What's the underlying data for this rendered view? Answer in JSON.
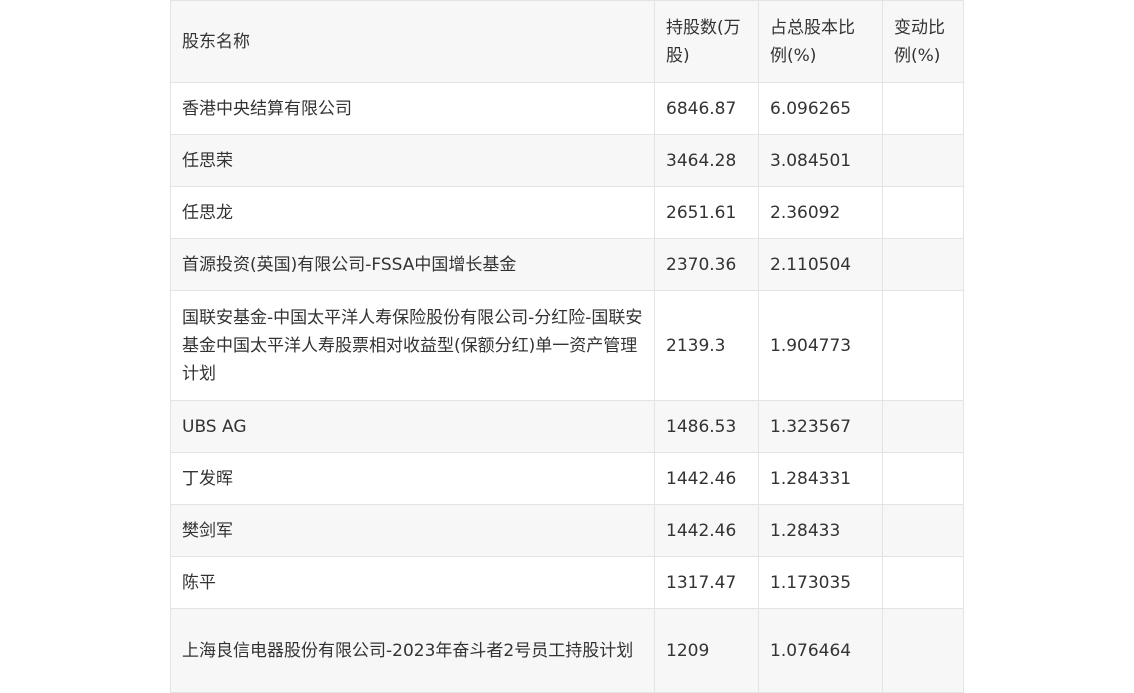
{
  "table": {
    "headers": [
      "股东名称",
      "持股数(万股)",
      "占总股本比例(%)",
      "变动比例(%)"
    ],
    "rows": [
      {
        "name": "香港中央结算有限公司",
        "shares": "6846.87",
        "ratio": "6.096265",
        "change": ""
      },
      {
        "name": "任思荣",
        "shares": "3464.28",
        "ratio": "3.084501",
        "change": ""
      },
      {
        "name": "任思龙",
        "shares": "2651.61",
        "ratio": "2.36092",
        "change": ""
      },
      {
        "name": "首源投资(英国)有限公司-FSSA中国增长基金",
        "shares": "2370.36",
        "ratio": "2.110504",
        "change": ""
      },
      {
        "name": "国联安基金-中国太平洋人寿保险股份有限公司-分红险-国联安基金中国太平洋人寿股票相对收益型(保额分红)单一资产管理计划",
        "shares": "2139.3",
        "ratio": "1.904773",
        "change": ""
      },
      {
        "name": "UBS AG",
        "shares": "1486.53",
        "ratio": "1.323567",
        "change": ""
      },
      {
        "name": "丁发晖",
        "shares": "1442.46",
        "ratio": "1.284331",
        "change": ""
      },
      {
        "name": "樊剑军",
        "shares": "1442.46",
        "ratio": "1.28433",
        "change": ""
      },
      {
        "name": "陈平",
        "shares": "1317.47",
        "ratio": "1.173035",
        "change": ""
      },
      {
        "name": "上海良信电器股份有限公司-2023年奋斗者2号员工持股计划",
        "shares": "1209",
        "ratio": "1.076464",
        "change": ""
      }
    ]
  }
}
